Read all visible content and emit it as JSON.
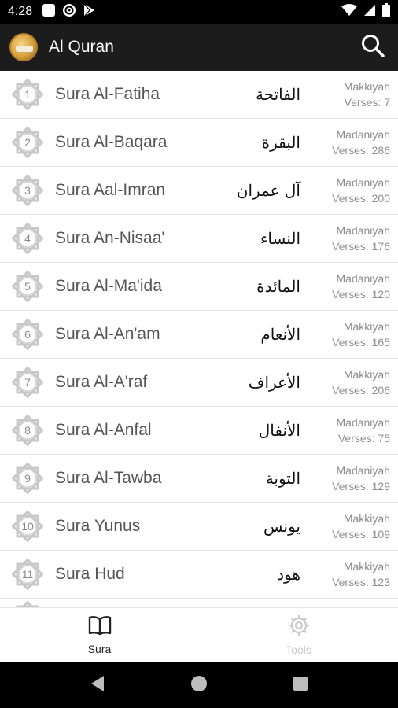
{
  "status_bar": {
    "time": "4:28"
  },
  "app_bar": {
    "title": "Al Quran"
  },
  "suras": [
    {
      "number": "1",
      "name": "Sura Al-Fatiha",
      "arabic": "الفاتحة",
      "type": "Makkiyah",
      "verses": "Verses: 7"
    },
    {
      "number": "2",
      "name": "Sura Al-Baqara",
      "arabic": "البقرة",
      "type": "Madaniyah",
      "verses": "Verses: 286"
    },
    {
      "number": "3",
      "name": "Sura Aal-Imran",
      "arabic": "آل عمران",
      "type": "Madaniyah",
      "verses": "Verses: 200"
    },
    {
      "number": "4",
      "name": "Sura An-Nisaa'",
      "arabic": "النساء",
      "type": "Madaniyah",
      "verses": "Verses: 176"
    },
    {
      "number": "5",
      "name": "Sura Al-Ma'ida",
      "arabic": "المائدة",
      "type": "Madaniyah",
      "verses": "Verses: 120"
    },
    {
      "number": "6",
      "name": "Sura Al-An'am",
      "arabic": "الأنعام",
      "type": "Makkiyah",
      "verses": "Verses: 165"
    },
    {
      "number": "7",
      "name": "Sura Al-A'raf",
      "arabic": "الأعراف",
      "type": "Makkiyah",
      "verses": "Verses: 206"
    },
    {
      "number": "8",
      "name": "Sura Al-Anfal",
      "arabic": "الأنفال",
      "type": "Madaniyah",
      "verses": "Verses: 75"
    },
    {
      "number": "9",
      "name": "Sura Al-Tawba",
      "arabic": "التوبة",
      "type": "Madaniyah",
      "verses": "Verses: 129"
    },
    {
      "number": "10",
      "name": "Sura Yunus",
      "arabic": "يونس",
      "type": "Makkiyah",
      "verses": "Verses: 109"
    },
    {
      "number": "11",
      "name": "Sura Hud",
      "arabic": "هود",
      "type": "Makkiyah",
      "verses": "Verses: 123"
    }
  ],
  "bottom_nav": {
    "sura": {
      "label": "Sura",
      "icon": "book-icon",
      "active": true
    },
    "tools": {
      "label": "Tools",
      "icon": "gear-icon",
      "active": false
    }
  },
  "colors": {
    "app_bar": "#1c1c1c",
    "status_bar": "#000000",
    "row_divider": "#e3e3e3",
    "badge": "#c8c8c8",
    "meta_text": "#8d8d8d"
  }
}
